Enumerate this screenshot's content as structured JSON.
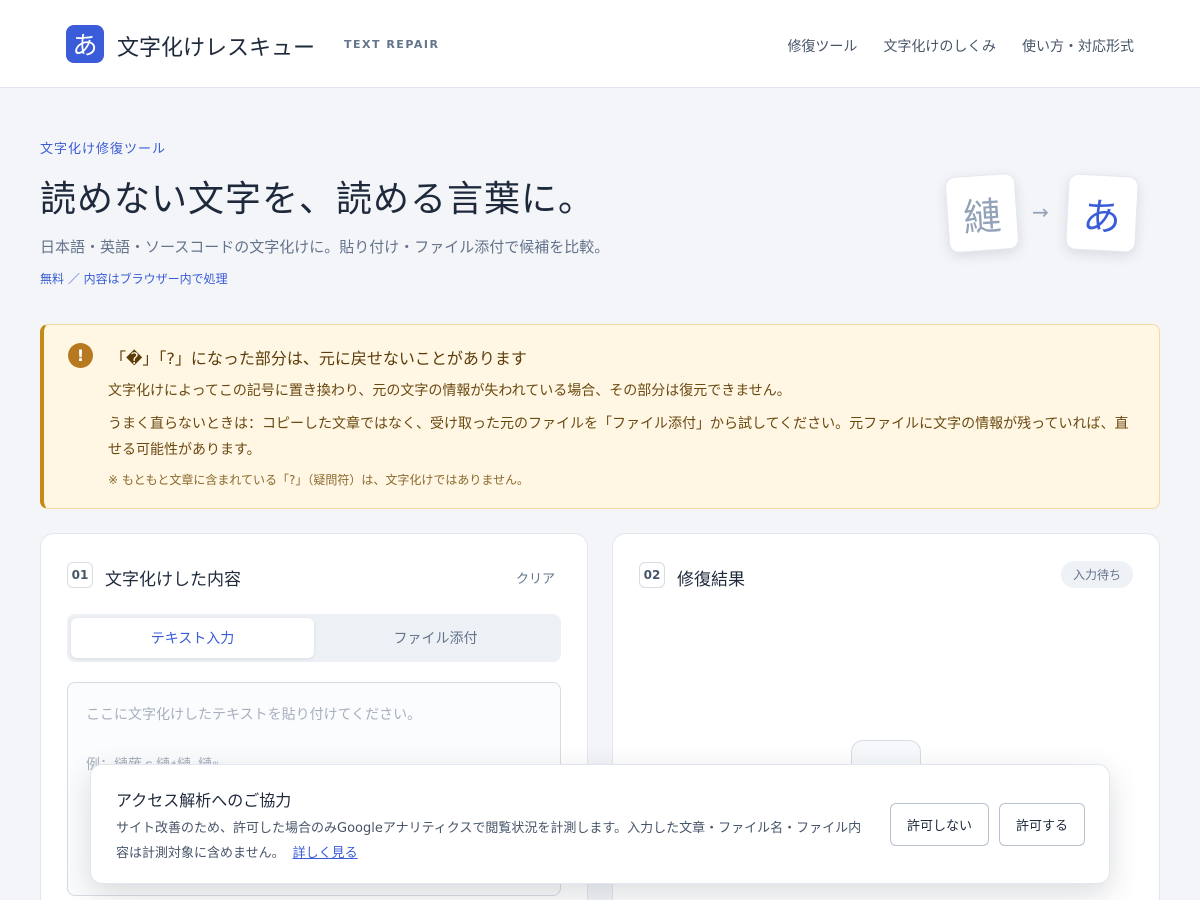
{
  "header": {
    "logo_char": "あ",
    "brand": "文字化けレスキュー",
    "tagline": "TEXT REPAIR",
    "nav": [
      "修復ツール",
      "文字化けのしくみ",
      "使い方・対応形式"
    ]
  },
  "hero": {
    "eyebrow": "文字化け修復ツール",
    "title": "読めない文字を、読める言葉に。",
    "subtitle": "日本語・英語・ソースコードの文字化けに。貼り付け・ファイル添付で候補を比較。",
    "note": "無料 ／ 内容はブラウザー内で処理",
    "broken_char": "縺",
    "arrow": "→",
    "fixed_char": "あ"
  },
  "warning": {
    "icon": "!",
    "title": "「�」「?」になった部分は、元に戻せないことがあります",
    "body1": "文字化けによってこの記号に置き換わり、元の文字の情報が失われている場合、その部分は復元できません。",
    "body2": "うまく直らないときは：コピーした文章ではなく、受け取った元のファイルを「ファイル添付」から試してください。元ファイルに文字の情報が残っていれば、直せる可能性があります。",
    "footnote": "※ もともと文章に含まれている「?」（疑問符）は、文字化けではありません。"
  },
  "input_panel": {
    "step": "01",
    "title": "文字化けした内容",
    "clear_label": "クリア",
    "tabs": [
      "テキスト入力",
      "ファイル添付"
    ],
    "placeholder": "ここに文字化けしたテキストを貼り付けてください。\n\n例：縺薙ｓ縺ｫ縺｡縺ｯ"
  },
  "result_panel": {
    "step": "02",
    "title": "修復結果",
    "status": "入力待ち"
  },
  "cookie": {
    "title": "アクセス解析へのご協力",
    "text": "サイト改善のため、許可した場合のみGoogleアナリティクスで閲覧状況を計測します。入力した文章・ファイル名・ファイル内容は計測対象に含めません。",
    "link": "詳しく見る",
    "deny": "許可しない",
    "allow": "許可する"
  },
  "colors": {
    "accent": "#3a5cd8",
    "warning_bg": "#fff6e3",
    "warning_border": "#c48a14"
  }
}
